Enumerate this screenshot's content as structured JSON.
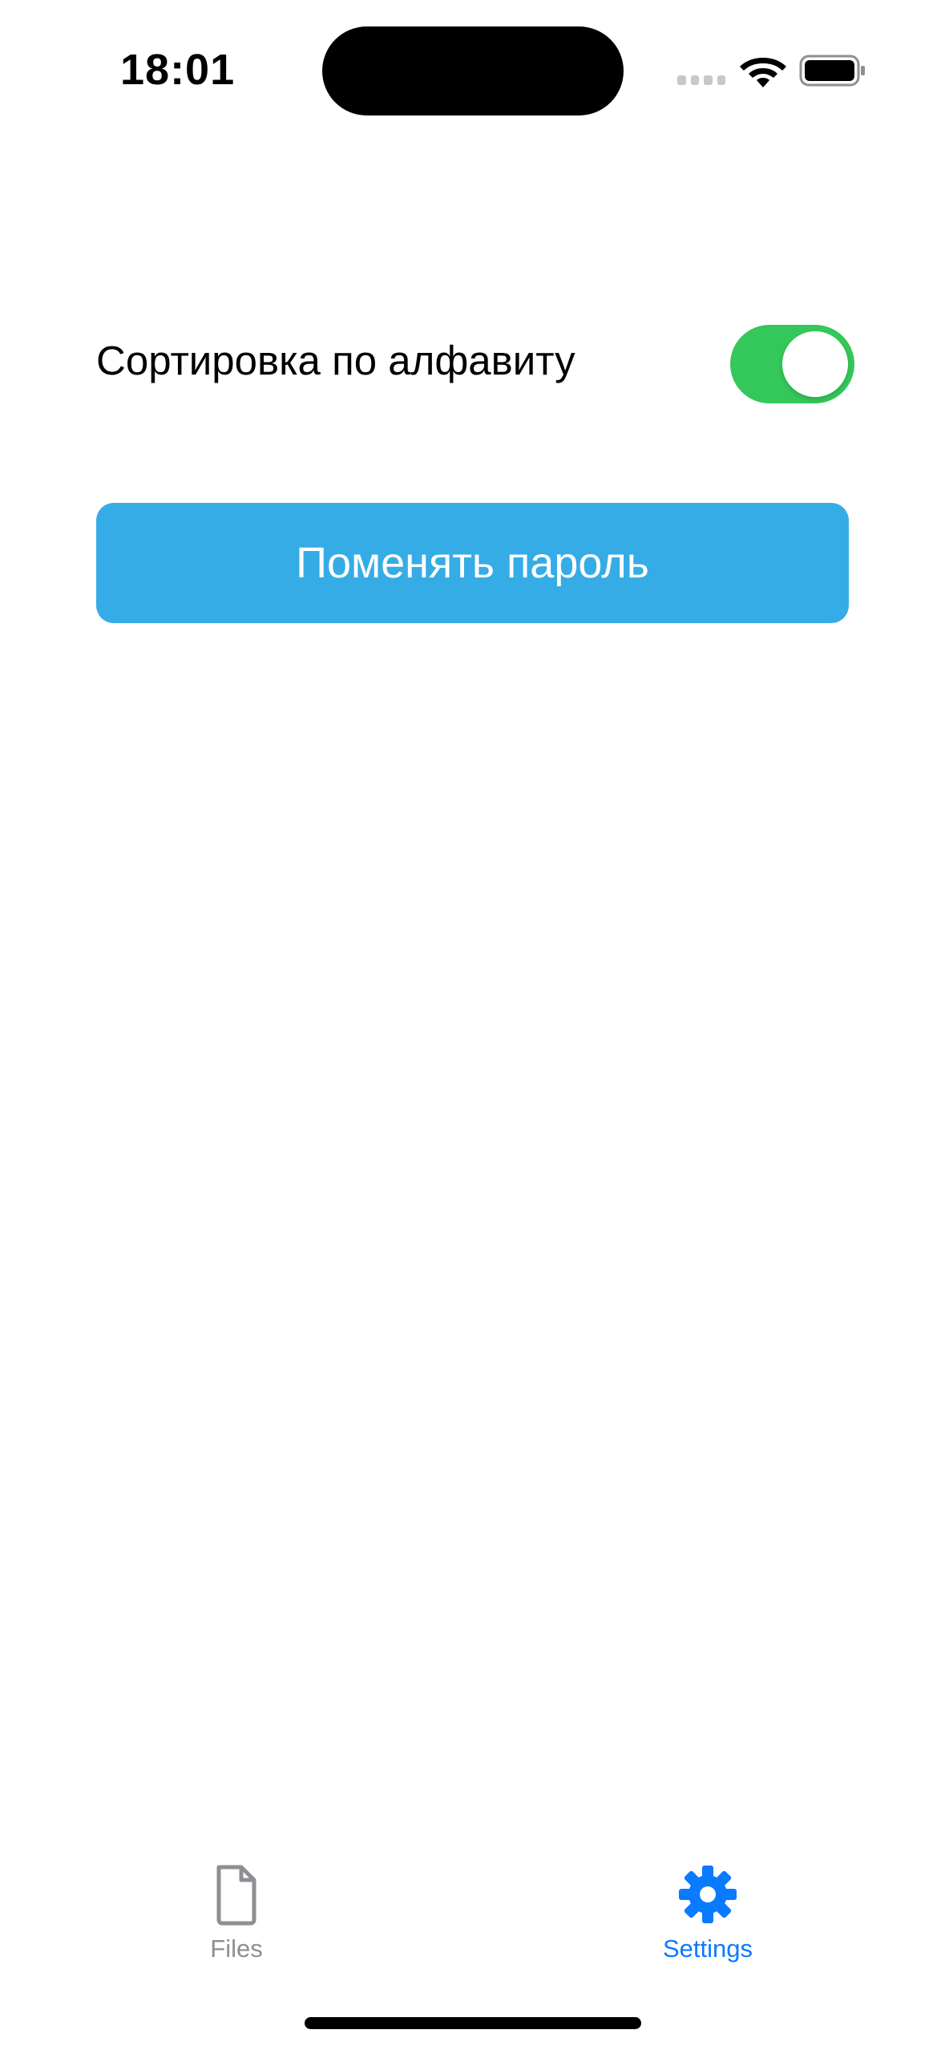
{
  "status_bar": {
    "time": "18:01"
  },
  "settings": {
    "sort_alphabetically": {
      "label": "Сортировка по алфавиту",
      "enabled": true,
      "on_color": "#34c759"
    },
    "change_password_button": {
      "label": "Поменять пароль",
      "color": "#35ace6"
    }
  },
  "tab_bar": {
    "items": [
      {
        "label": "Files",
        "icon": "document-icon",
        "selected": false,
        "color": "#8e8e93"
      },
      {
        "label": "Settings",
        "icon": "gear-icon",
        "selected": true,
        "color": "#0a7aff"
      }
    ]
  }
}
